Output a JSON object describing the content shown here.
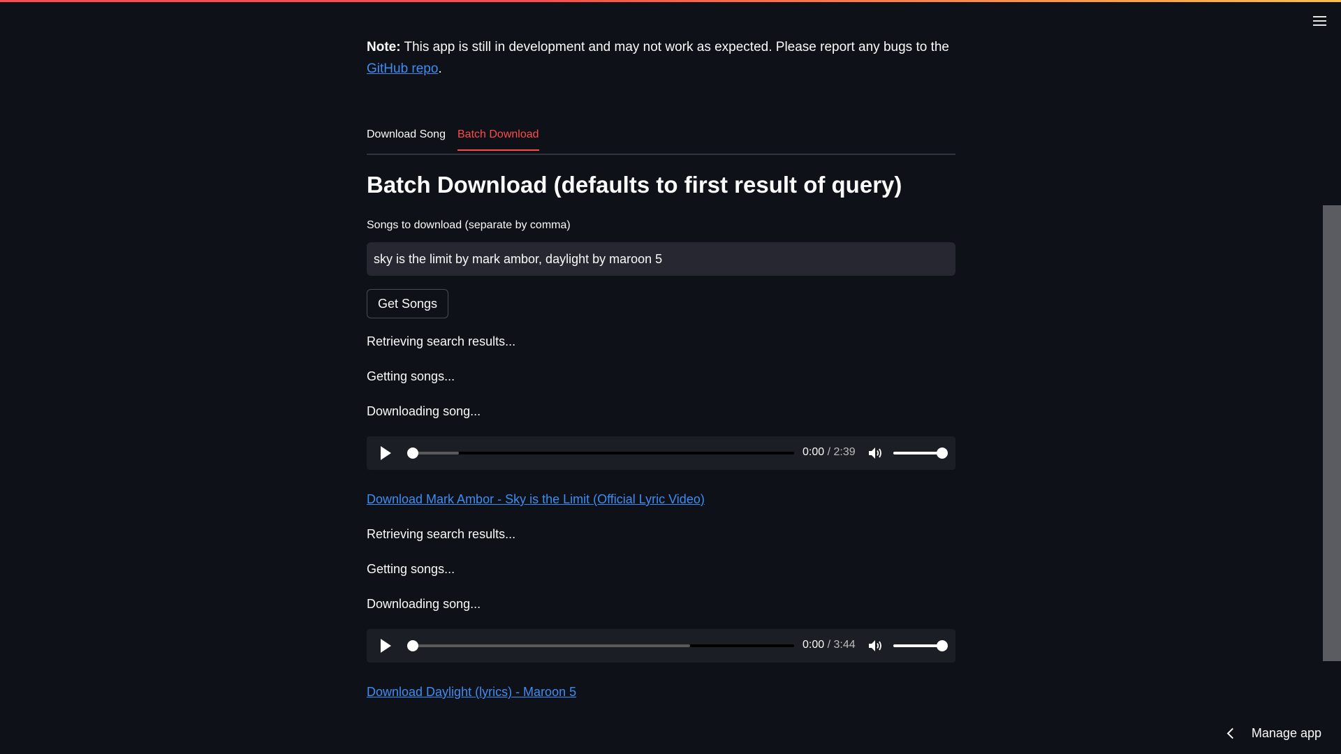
{
  "note": {
    "prefix": "Note:",
    "text": " This app is still in development and may not work as expected. Please report any bugs to the ",
    "link_label": "GitHub repo",
    "suffix": "."
  },
  "tabs": [
    {
      "label": "Download Song",
      "active": false
    },
    {
      "label": "Batch Download",
      "active": true
    }
  ],
  "page_title": "Batch Download (defaults to first result of query)",
  "songs_input": {
    "label": "Songs to download (separate by comma)",
    "value": "sky is the limit by mark ambor, daylight by maroon 5"
  },
  "get_songs_button": "Get Songs",
  "results": [
    {
      "status": [
        "Retrieving search results...",
        "Getting songs...",
        "Downloading song..."
      ],
      "player": {
        "current_time": "0:00",
        "separator": "/",
        "duration": "2:39",
        "progress": 0.0,
        "buffered": 0.13,
        "volume": 1.0
      },
      "download_link": "Download Mark Ambor - Sky is the Limit (Official Lyric Video)"
    },
    {
      "status": [
        "Retrieving search results...",
        "Getting songs...",
        "Downloading song..."
      ],
      "player": {
        "current_time": "0:00",
        "separator": "/",
        "duration": "3:44",
        "progress": 0.0,
        "buffered": 0.73,
        "volume": 1.0
      },
      "download_link": "Download Daylight (lyrics) - Maroon 5"
    }
  ],
  "manage_app": "Manage app",
  "icons": {
    "menu": "hamburger-menu-icon",
    "play": "play-icon",
    "volume": "volume-icon",
    "chevron": "chevron-left-icon"
  },
  "colors": {
    "background": "#0e1117",
    "accent": "#ff4b4b",
    "link": "#3d8df5"
  }
}
